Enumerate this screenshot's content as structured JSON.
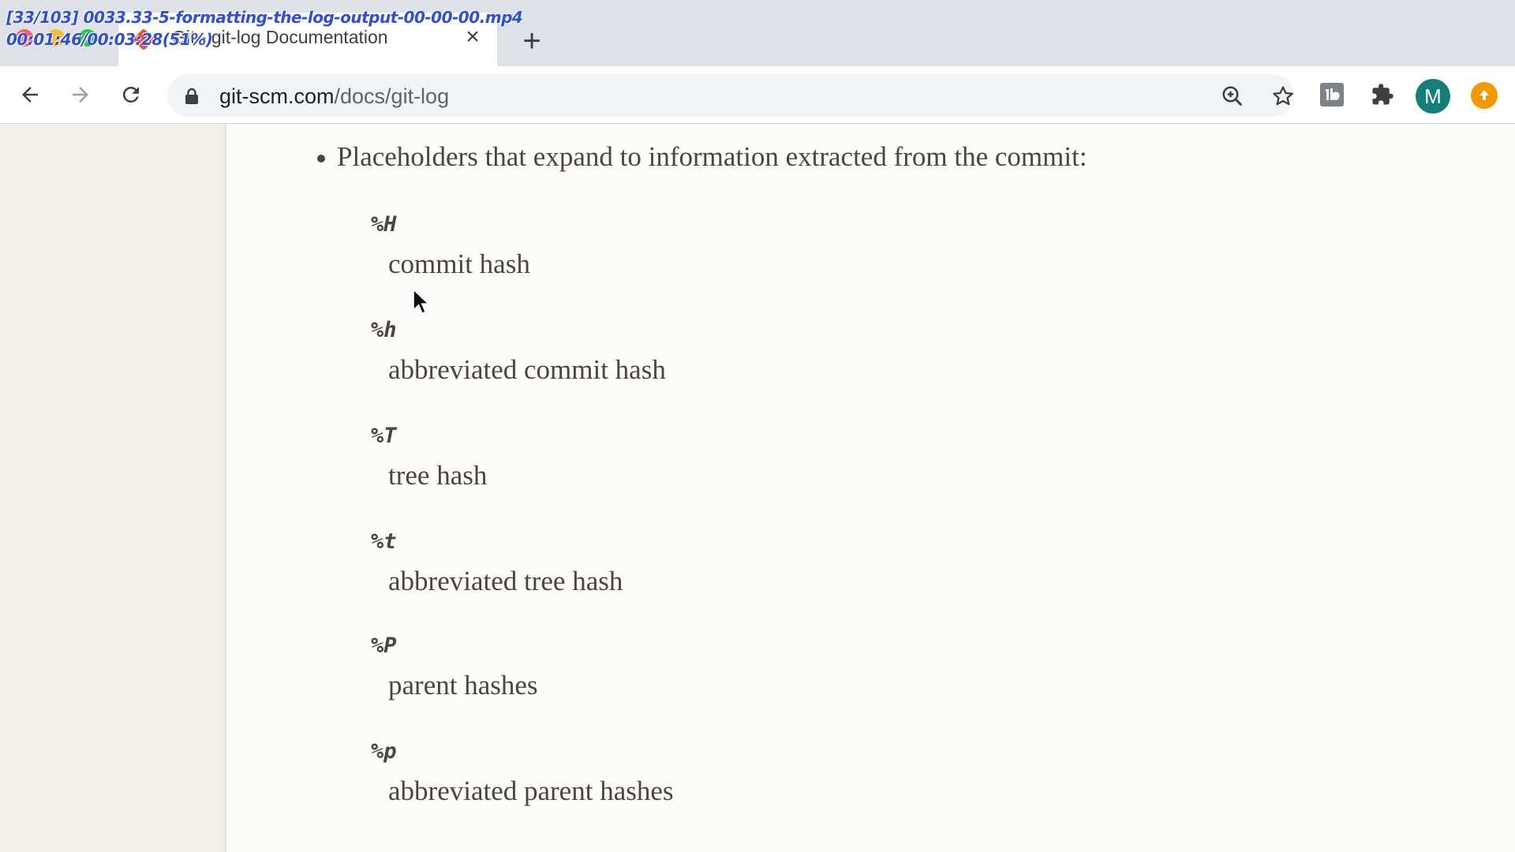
{
  "browser": {
    "tab": {
      "title": "Git - git-log Documentation",
      "close_icon": "×"
    },
    "new_tab_icon": "+",
    "url": {
      "domain": "git-scm.com",
      "path": "/docs/git-log"
    },
    "profile_initial": "M",
    "colors": {
      "tab_strip": "#dee1e6",
      "avatar": "#137e7a",
      "update_badge": "#f29900"
    }
  },
  "video_overlay": {
    "line1": "[33/103] 0033.33-5-formatting-the-log-output-00-00-00.mp4",
    "line2": "00:01:46/00:03:28(51%)"
  },
  "page": {
    "intro": "Placeholders that expand to information extracted from the commit:",
    "placeholders": [
      {
        "code": "%H",
        "description": "commit hash"
      },
      {
        "code": "%h",
        "description": "abbreviated commit hash"
      },
      {
        "code": "%T",
        "description": "tree hash"
      },
      {
        "code": "%t",
        "description": "abbreviated tree hash"
      },
      {
        "code": "%P",
        "description": "parent hashes"
      },
      {
        "code": "%p",
        "description": "abbreviated parent hashes"
      }
    ],
    "colors": {
      "sidebar": "#f0f0e8",
      "text": "#4e443c"
    }
  }
}
